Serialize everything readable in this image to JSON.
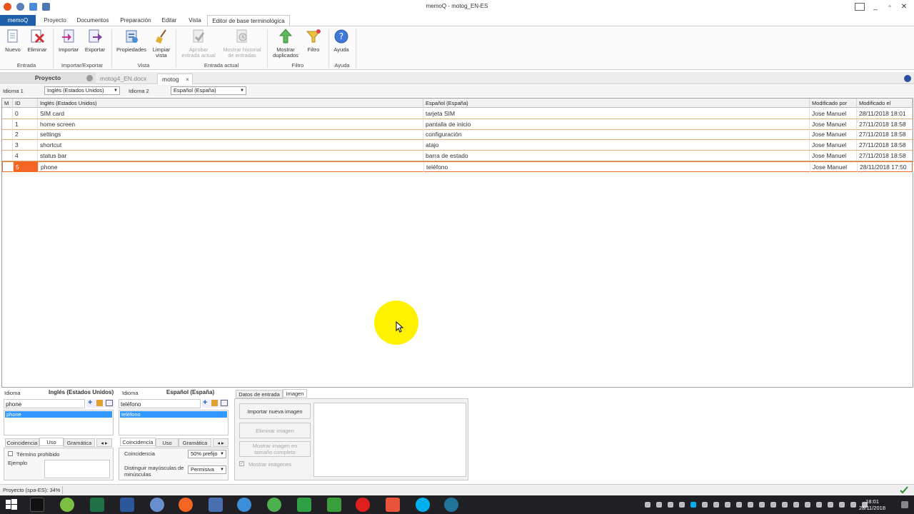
{
  "window": {
    "title": "memoQ - motog_EN-ES",
    "minimize": "_",
    "maximize": "▫",
    "close": "✕"
  },
  "ribbon_tabs": [
    "memoQ",
    "Proyecto",
    "Documentos",
    "Preparación",
    "Editar",
    "Vista",
    "Editor de base terminológica"
  ],
  "ribbon": {
    "buttons": {
      "nuevo": "Nuevo",
      "eliminar": "Eliminar",
      "importar": "Importar",
      "exportar": "Exportar",
      "propiedades": "Propiedades",
      "limpiar_vista_1": "Limpiar",
      "limpiar_vista_2": "vista",
      "aprobar_1": "Aprobar",
      "aprobar_2": "entrada actual",
      "historial_1": "Mostrar historial",
      "historial_2": "de entradas",
      "duplicados_1": "Mostrar",
      "duplicados_2": "duplicados",
      "filtro": "Filtro",
      "ayuda": "Ayuda"
    },
    "groups": {
      "entrada": "Entrada",
      "importexport": "Importar/Exportar",
      "vista": "Vista",
      "entrada_actual": "Entrada actual",
      "filtro": "Filtro",
      "ayuda": "Ayuda"
    }
  },
  "doc_tabs": {
    "proyecto": "Proyecto",
    "doc1": "motog4_EN.docx",
    "doc2": "motog",
    "close": "×"
  },
  "language_bar": {
    "idioma1_label": "Idioma 1",
    "idioma1_value": "Inglés (Estados Unidos)",
    "idioma2_label": "Idioma 2",
    "idioma2_value": "Español (España)"
  },
  "grid": {
    "columns": [
      "M",
      "ID",
      "Inglés (Estados Unidos)",
      "Español (España)",
      "Modificado por",
      "Modificado el"
    ],
    "rows": [
      {
        "id": "0",
        "en": "SIM card",
        "es": "tarjeta SIM",
        "by": "Jose Manuel",
        "date": "28/11/2018 18:01"
      },
      {
        "id": "1",
        "en": "home screen",
        "es": "pantalla de inicio",
        "by": "Jose Manuel",
        "date": "27/11/2018 18:58"
      },
      {
        "id": "2",
        "en": "settings",
        "es": "configuración",
        "by": "Jose Manuel",
        "date": "27/11/2018 18:58"
      },
      {
        "id": "3",
        "en": "shortcut",
        "es": "atajo",
        "by": "Jose Manuel",
        "date": "27/11/2018 18:58"
      },
      {
        "id": "4",
        "en": "status bar",
        "es": "barra de estado",
        "by": "Jose Manuel",
        "date": "27/11/2018 18:58"
      },
      {
        "id": "5",
        "en": "phone",
        "es": "teléfono",
        "by": "Jose Manuel",
        "date": "28/11/2018 17:50"
      }
    ],
    "selected_row": 5
  },
  "entry_panel": {
    "left": {
      "idioma_label": "Idioma",
      "lang": "Inglés (Estados Unidos)",
      "term_input": "phone",
      "list_item": "phone",
      "tabs": [
        "Coincidencia",
        "Uso",
        "Gramática"
      ],
      "termino_prohibido": "Término prohibido",
      "ejemplo": "Ejemplo"
    },
    "right": {
      "idioma_label": "Idioma",
      "lang": "Español (España)",
      "term_input": "teléfono",
      "list_item": "teléfono",
      "tabs": [
        "Coincidencia",
        "Uso",
        "Gramática"
      ],
      "coincidencia_label": "Coincidencia",
      "coincidencia_value": "50% prefijo",
      "mayus_label_1": "Distinguir mayúsculas de",
      "mayus_label_2": "minúsculas",
      "mayus_value": "Permisiva"
    },
    "image_panel": {
      "tabs": [
        "Datos de entrada",
        "Imagen"
      ],
      "importar": "Importar nueva imagen",
      "eliminar": "Eliminar imagen",
      "mostrar_1": "Mostrar imagen en",
      "mostrar_2": "tamaño completo",
      "mostrar_imagenes": "Mostrar imágenes"
    }
  },
  "status": {
    "text": "Proyecto (spa-ES): 34%"
  },
  "taskbar": {
    "time": "18:01",
    "date": "28/11/2018"
  }
}
